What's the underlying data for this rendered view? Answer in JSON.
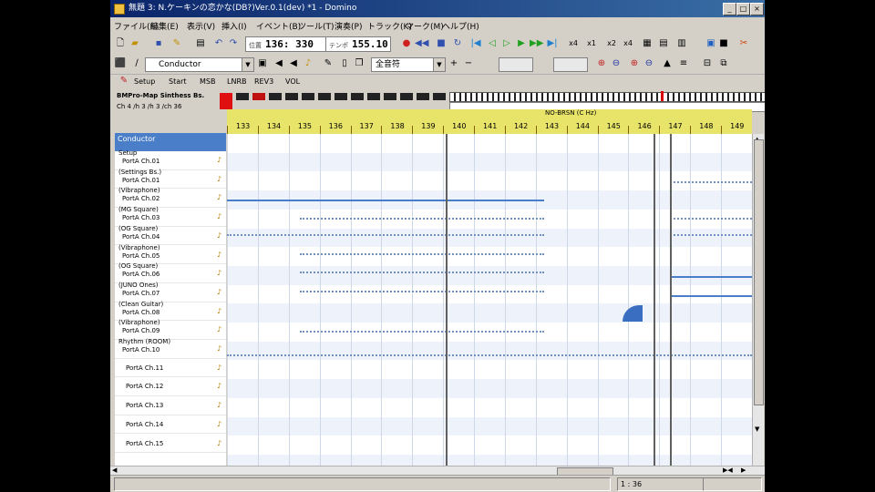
{
  "window": {
    "title": "無題 3: N.ケーキンの恋かな(DB?)Ver.0.1(dev) *1 - Domino",
    "minimize": "_",
    "maximize": "□",
    "close": "×"
  },
  "menu": [
    "ファイル(F)",
    "編集(E)",
    "表示(V)",
    "挿入(I)",
    "イベント(B)",
    "ツール(T)",
    "演奏(P)",
    "トラック(K)",
    "マーク(M)",
    "ヘルプ(H)"
  ],
  "toolbar": {
    "position_label": "位置",
    "position": "136: 330",
    "tempo_label": "テンポ",
    "tempo": "155.10",
    "zoom_buttons": [
      "x4",
      "x1",
      "x2",
      "x4"
    ]
  },
  "toolbar2": {
    "track_name": "Conductor",
    "filter": "全音符"
  },
  "tabs": [
    "Setup",
    "Start",
    "MSB",
    "LNRB",
    "REV3",
    "VOL"
  ],
  "status": {
    "device": "BMPro-Map Sinthess Bs.",
    "values": "Ch  4  /h  3 /h  3 /ch  36"
  },
  "ruler": {
    "bars": [
      "133",
      "134",
      "135",
      "136",
      "137",
      "138",
      "139",
      "140",
      "141",
      "142",
      "143",
      "144",
      "145",
      "146",
      "147",
      "148",
      "149"
    ],
    "marker": "NO-BRSN (C Hz)"
  },
  "tracklist": {
    "header": "Conductor",
    "tracks": [
      {
        "name": "Setup",
        "port": "PortA  Ch.01"
      },
      {
        "name": "(Settings Bs.)",
        "port": "PortA  Ch.01"
      },
      {
        "name": "(Vibraphone)",
        "port": "PortA  Ch.02"
      },
      {
        "name": "(MG Square)",
        "port": "PortA  Ch.03"
      },
      {
        "name": "(OG Square)",
        "port": "PortA  Ch.04"
      },
      {
        "name": "(Vibraphone)",
        "port": "PortA  Ch.05"
      },
      {
        "name": "(OG Square)",
        "port": "PortA  Ch.06"
      },
      {
        "name": "(JUNO Ones)",
        "port": "PortA  Ch.07"
      },
      {
        "name": "(Clean Guitar)",
        "port": "PortA  Ch.08"
      },
      {
        "name": "(Vibraphone)",
        "port": "PortA  Ch.09"
      },
      {
        "name": "Rhythm (ROOM)",
        "port": "PortA  Ch.10"
      },
      {
        "name": "",
        "port": "PortA  Ch.11"
      },
      {
        "name": "",
        "port": "PortA  Ch.12"
      },
      {
        "name": "",
        "port": "PortA  Ch.13"
      },
      {
        "name": "",
        "port": "PortA  Ch.14"
      },
      {
        "name": "",
        "port": "PortA  Ch.15"
      }
    ]
  },
  "statusbar": {
    "position": "1 : 36"
  },
  "colors": {
    "title_start": "#0a246a",
    "title_end": "#3a6ea5",
    "selected_track": "#4a7ec8",
    "ruler": "#e8e46a",
    "event_line": "#4a7ec8"
  }
}
